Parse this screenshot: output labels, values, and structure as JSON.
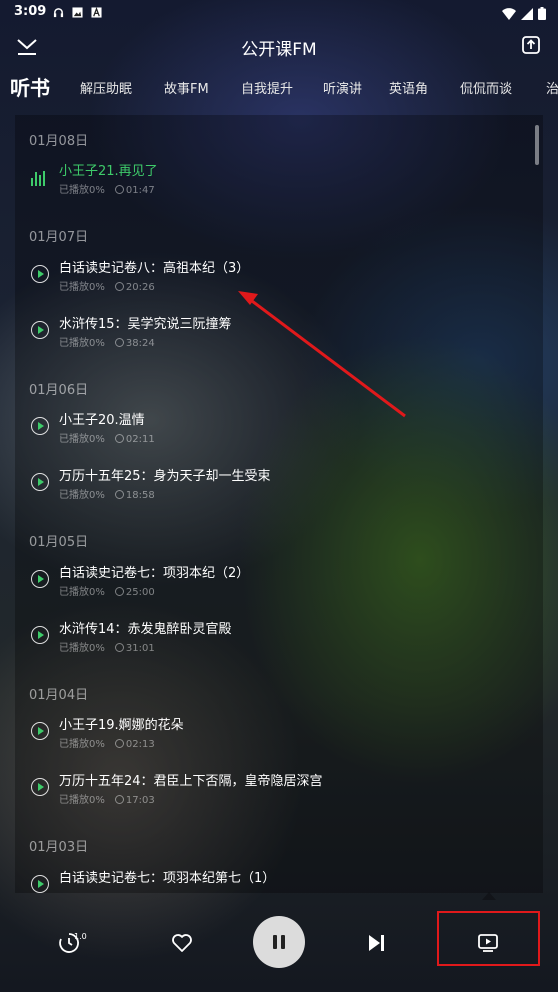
{
  "status": {
    "time": "3:09"
  },
  "header": {
    "title": "公开课FM"
  },
  "tabs": [
    "听书",
    "解压助眠",
    "故事FM",
    "自我提升",
    "听演讲",
    "英语角",
    "侃侃而谈",
    "治"
  ],
  "playlist": {
    "groups": [
      {
        "date": "01月08日",
        "items": [
          {
            "title": "小王子21.再见了",
            "progress": "已播放0%",
            "duration": "01:47",
            "playing": true
          }
        ]
      },
      {
        "date": "01月07日",
        "items": [
          {
            "title": "白话读史记卷八：高祖本纪（3）",
            "progress": "已播放0%",
            "duration": "20:26"
          },
          {
            "title": "水浒传15：吴学究说三阮撞筹",
            "progress": "已播放0%",
            "duration": "38:24"
          }
        ]
      },
      {
        "date": "01月06日",
        "items": [
          {
            "title": "小王子20.温情",
            "progress": "已播放0%",
            "duration": "02:11"
          },
          {
            "title": "万历十五年25：身为天子却一生受束",
            "progress": "已播放0%",
            "duration": "18:58"
          }
        ]
      },
      {
        "date": "01月05日",
        "items": [
          {
            "title": "白话读史记卷七：项羽本纪（2）",
            "progress": "已播放0%",
            "duration": "25:00"
          },
          {
            "title": "水浒传14：赤发鬼醉卧灵官殿",
            "progress": "已播放0%",
            "duration": "31:01"
          }
        ]
      },
      {
        "date": "01月04日",
        "items": [
          {
            "title": "小王子19.婀娜的花朵",
            "progress": "已播放0%",
            "duration": "02:13"
          },
          {
            "title": "万历十五年24：君臣上下否隔，皇帝隐居深宫",
            "progress": "已播放0%",
            "duration": "17:03"
          }
        ]
      },
      {
        "date": "01月03日",
        "items": [
          {
            "title": "白话读史记卷七：项羽本纪第七（1）",
            "progress": "",
            "duration": ""
          }
        ]
      }
    ]
  },
  "controls": {
    "speed": "1.0"
  },
  "colors": {
    "accent": "#3ecb6a",
    "annotation": "#e0191b"
  },
  "icons": [
    "chevron-down-icon",
    "share-icon",
    "timer-icon",
    "heart-icon",
    "pause-icon",
    "skip-next-icon",
    "playlist-icon"
  ]
}
